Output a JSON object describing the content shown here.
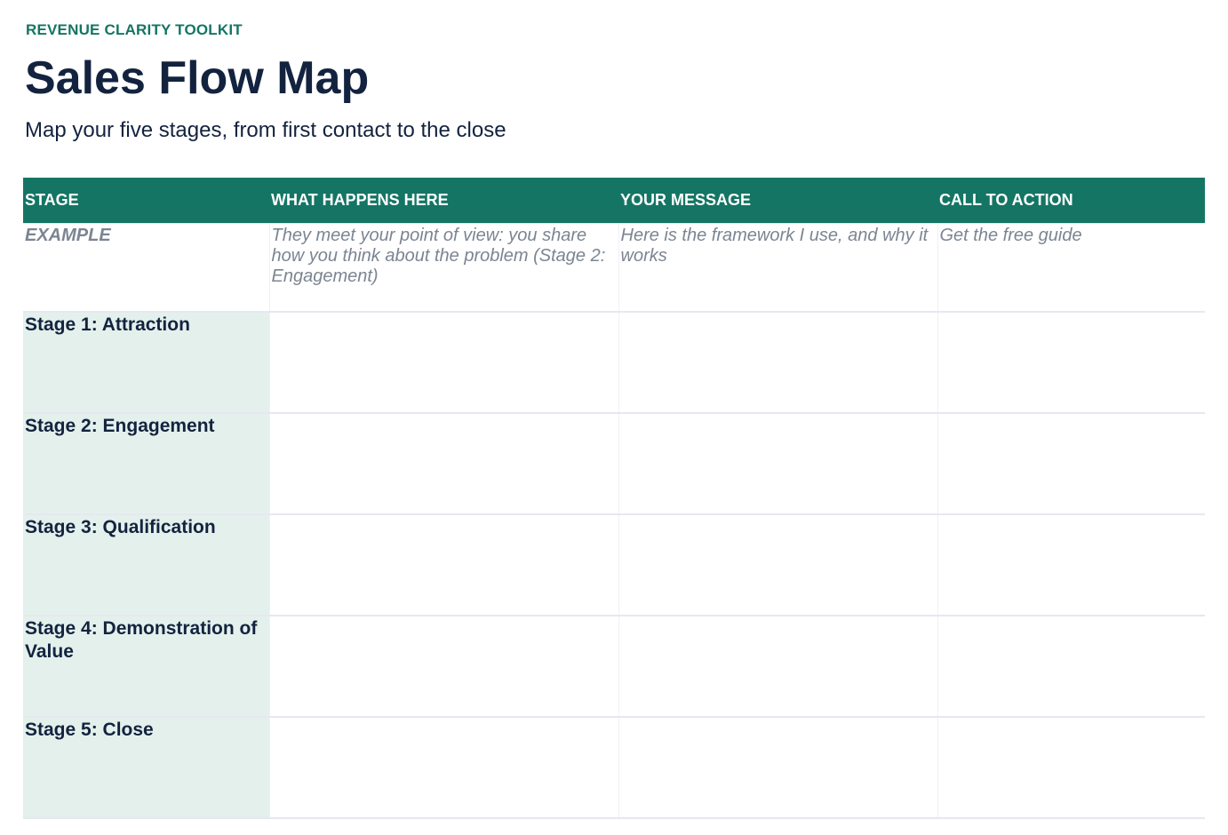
{
  "header": {
    "eyebrow": "REVENUE CLARITY TOOLKIT",
    "title": "Sales Flow Map",
    "subtitle": "Map your five stages, from first contact to the close"
  },
  "table": {
    "columns": [
      "STAGE",
      "WHAT HAPPENS HERE",
      "YOUR MESSAGE",
      "CALL TO ACTION"
    ],
    "example": {
      "label": "EXAMPLE",
      "what_happens": "They meet your point of view: you share how you think about the problem (Stage 2: Engagement)",
      "message": "Here is the framework I use, and why it works",
      "cta": "Get the free guide"
    },
    "stages": [
      {
        "label": "Stage 1: Attraction",
        "what_happens": "",
        "message": "",
        "cta": ""
      },
      {
        "label": "Stage 2: Engagement",
        "what_happens": "",
        "message": "",
        "cta": ""
      },
      {
        "label": "Stage 3: Qualification",
        "what_happens": "",
        "message": "",
        "cta": ""
      },
      {
        "label": "Stage 4: Demonstration of Value",
        "what_happens": "",
        "message": "",
        "cta": ""
      },
      {
        "label": "Stage 5: Close",
        "what_happens": "",
        "message": "",
        "cta": ""
      }
    ]
  },
  "colors": {
    "accent": "#147564",
    "heading": "#13233f",
    "stage_fill": "#e4f0ec",
    "example_text": "#7b8592"
  }
}
